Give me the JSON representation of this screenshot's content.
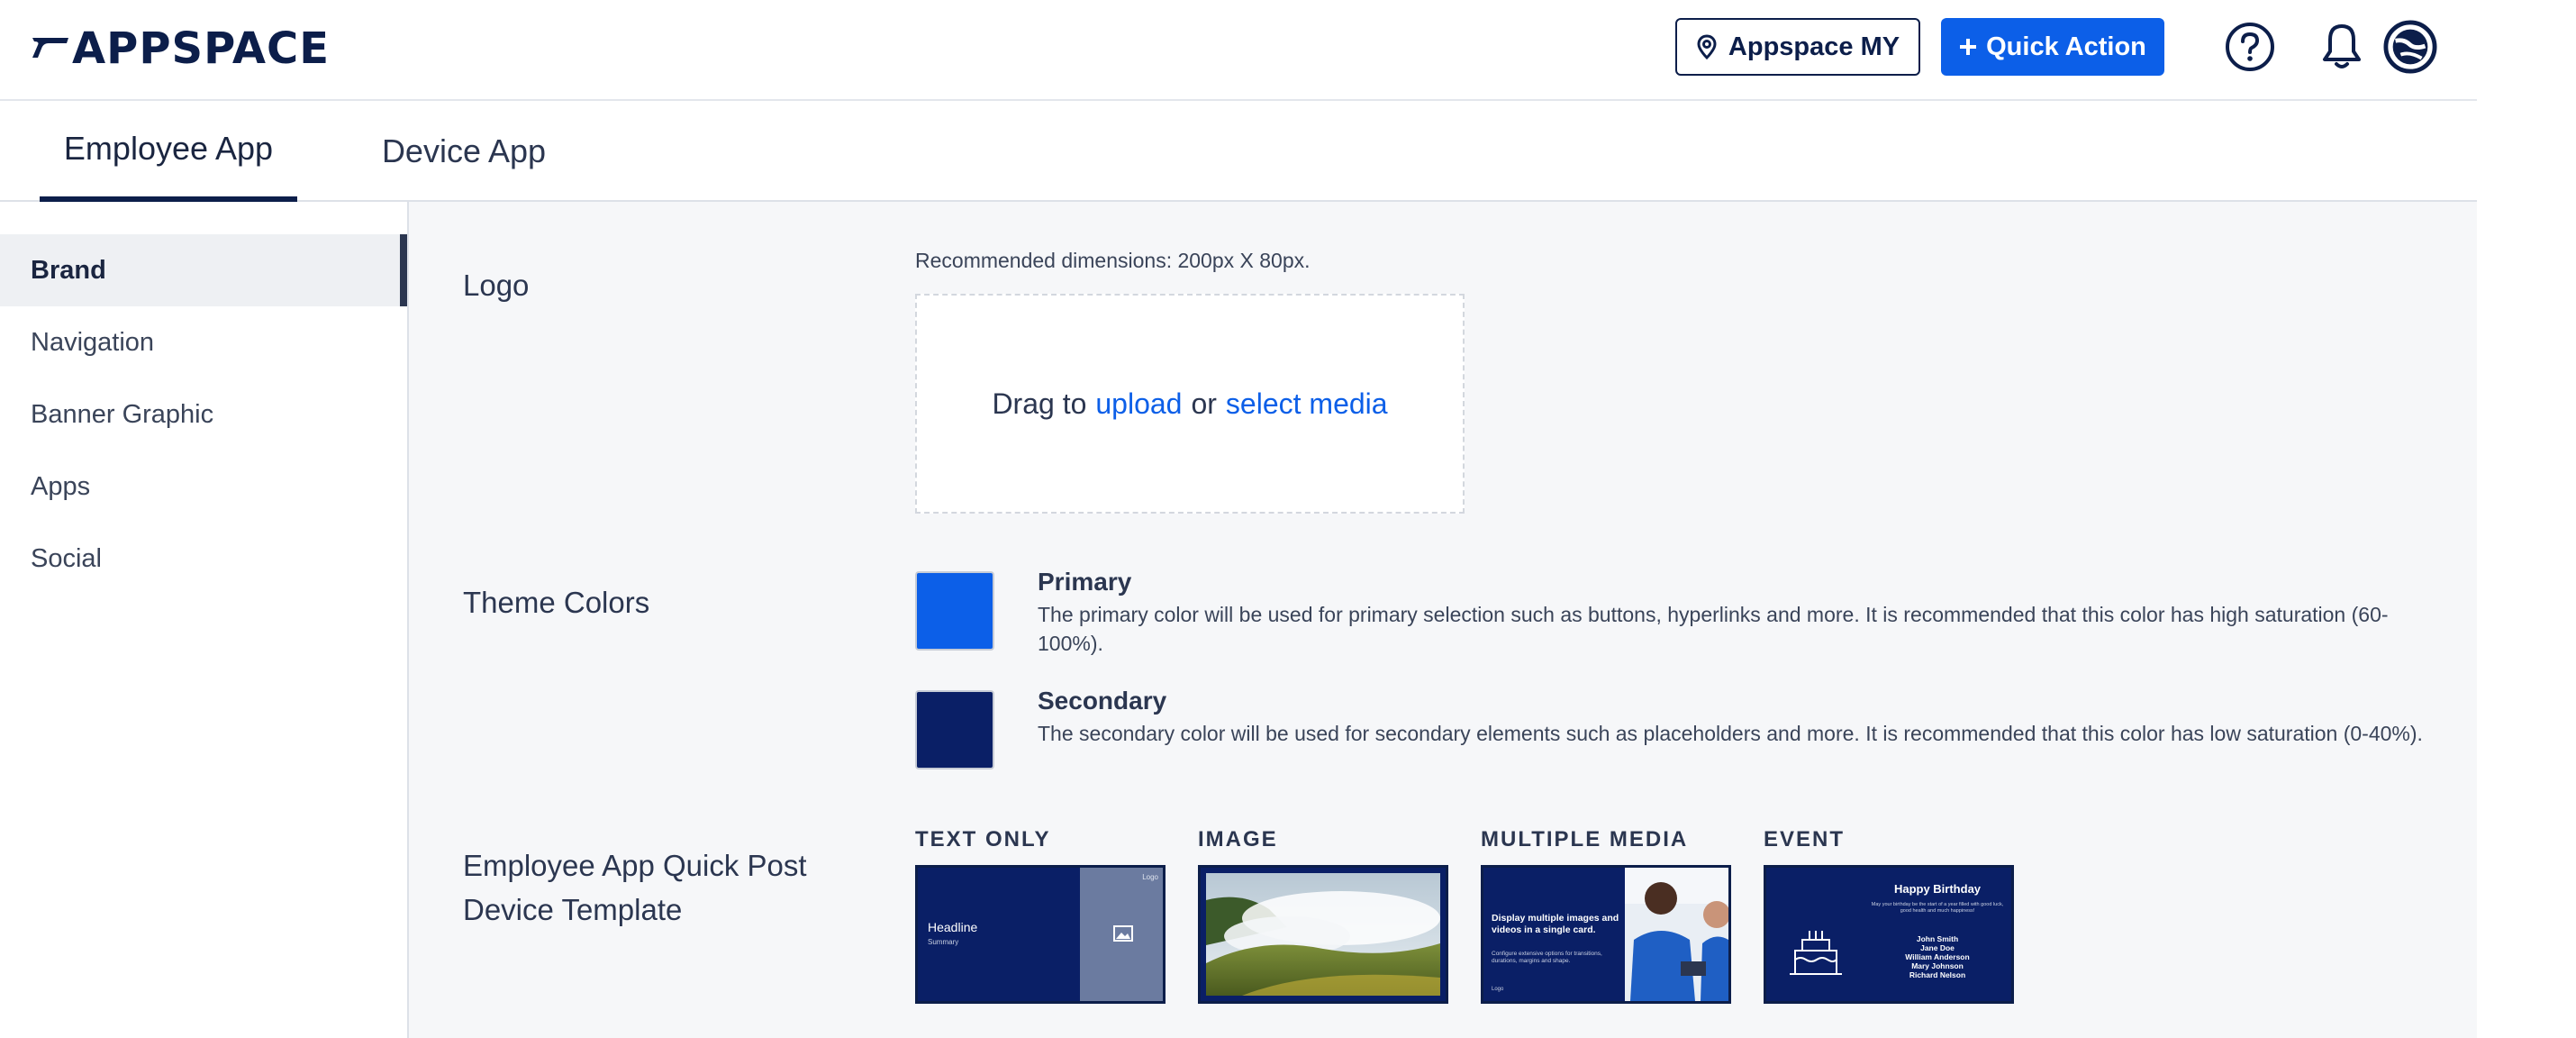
{
  "header": {
    "brand": "APPSPACE",
    "location_label": "Appspace MY",
    "quick_action_label": "Quick Action"
  },
  "icons": {
    "location": "map-pin-icon",
    "plus": "plus-icon",
    "help": "question-circle-icon",
    "notifications": "bell-icon",
    "profile": "globe-avatar-icon"
  },
  "tabs": [
    {
      "label": "Employee App",
      "active": true
    },
    {
      "label": "Device App",
      "active": false
    }
  ],
  "sidebar": {
    "items": [
      {
        "label": "Brand",
        "active": true
      },
      {
        "label": "Navigation"
      },
      {
        "label": "Banner Graphic"
      },
      {
        "label": "Apps"
      },
      {
        "label": "Social"
      }
    ]
  },
  "logo_section": {
    "label": "Logo",
    "hint": "Recommended dimensions: 200px X 80px.",
    "drop_prefix": "Drag to",
    "upload_link": "upload",
    "or_text": "or",
    "select_link": "select media"
  },
  "theme_section": {
    "label": "Theme Colors",
    "primary": {
      "title": "Primary",
      "color": "#0c5fe8",
      "description": "The primary color will be used for primary selection such as buttons, hyperlinks and more. It is recommended that this color has high saturation (60-100%)."
    },
    "secondary": {
      "title": "Secondary",
      "color": "#0a1f66",
      "description": "The secondary color will be used for secondary elements such as placeholders and more. It is recommended that this color has low saturation (0-40%)."
    }
  },
  "template_section": {
    "label_line1": "Employee App Quick Post",
    "label_line2": "Device Template",
    "templates": [
      {
        "label": "TEXT ONLY",
        "headline": "Headline",
        "summary": "Summary",
        "logo": "Logo"
      },
      {
        "label": "IMAGE"
      },
      {
        "label": "MULTIPLE MEDIA",
        "headline": "Display multiple images and videos in a single card.",
        "body": "Configure extensive options for transitions, durations, margins and shape.",
        "logo": "Logo"
      },
      {
        "label": "EVENT",
        "title": "Happy Birthday",
        "message": "May your birthday be the start of a year filled with good luck, good health and much happiness!",
        "names": [
          "John Smith",
          "Jane Doe",
          "William Anderson",
          "Mary Johnson",
          "Richard Nelson"
        ]
      }
    ]
  }
}
